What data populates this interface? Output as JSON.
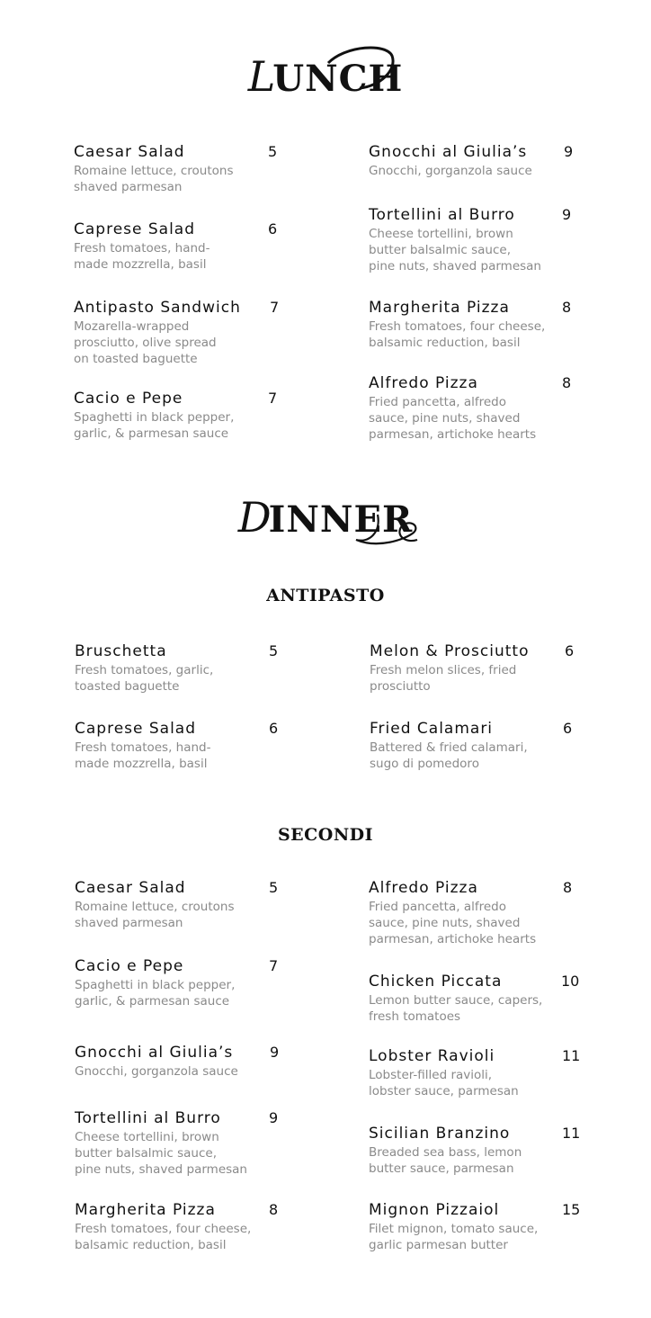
{
  "lunch": {
    "title_initial": "L",
    "title_rest": "UNCH",
    "items": [
      {
        "name": "Caesar Salad",
        "desc": "Romaine lettuce, croutons\nshaved parmesan",
        "price": "5"
      },
      {
        "name": "Caprese Salad",
        "desc": "Fresh tomatoes, hand-\nmade mozzrella, basil",
        "price": "6"
      },
      {
        "name": "Antipasto Sandwich",
        "desc": "Mozarella-wrapped\nprosciutto, olive spread\non toasted baguette",
        "price": "7"
      },
      {
        "name": "Cacio e Pepe",
        "desc": "Spaghetti in black pepper,\ngarlic, & parmesan sauce",
        "price": "7"
      },
      {
        "name": "Gnocchi al Giulia’s",
        "desc": "Gnocchi, gorganzola sauce",
        "price": "9"
      },
      {
        "name": "Tortellini al Burro",
        "desc": "Cheese tortellini, brown\nbutter balsalmic sauce,\npine nuts, shaved parmesan",
        "price": "9"
      },
      {
        "name": "Margherita Pizza",
        "desc": "Fresh tomatoes, four cheese,\nbalsamic reduction, basil",
        "price": "8"
      },
      {
        "name": "Alfredo Pizza",
        "desc": "Fried pancetta, alfredo\nsauce, pine nuts, shaved\nparmesan, artichoke hearts",
        "price": "8"
      }
    ]
  },
  "dinner": {
    "title_initial": "D",
    "title_rest": "INNER",
    "antipasto": {
      "title": "ANTIPASTO",
      "items": [
        {
          "name": "Bruschetta",
          "desc": "Fresh tomatoes, garlic,\ntoasted baguette",
          "price": "5"
        },
        {
          "name": "Caprese Salad",
          "desc": "Fresh tomatoes, hand-\nmade mozzrella, basil",
          "price": "6"
        },
        {
          "name": "Melon & Prosciutto",
          "desc": "Fresh melon slices, fried\nprosciutto",
          "price": "6"
        },
        {
          "name": "Fried Calamari",
          "desc": "Battered & fried calamari,\nsugo di pomedoro",
          "price": "6"
        }
      ]
    },
    "secondi": {
      "title": "SECONDI",
      "items": [
        {
          "name": "Caesar Salad",
          "desc": "Romaine lettuce, croutons\nshaved parmesan",
          "price": "5"
        },
        {
          "name": "Cacio e Pepe",
          "desc": "Spaghetti in black pepper,\ngarlic, & parmesan sauce",
          "price": "7"
        },
        {
          "name": "Gnocchi al Giulia’s",
          "desc": "Gnocchi, gorganzola sauce",
          "price": "9"
        },
        {
          "name": "Tortellini al Burro",
          "desc": "Cheese tortellini, brown\nbutter balsalmic sauce,\npine nuts, shaved parmesan",
          "price": "9"
        },
        {
          "name": "Margherita Pizza",
          "desc": "Fresh tomatoes, four cheese,\nbalsamic reduction, basil",
          "price": "8"
        },
        {
          "name": "Alfredo Pizza",
          "desc": "Fried pancetta, alfredo\nsauce, pine nuts, shaved\nparmesan, artichoke hearts",
          "price": "8"
        },
        {
          "name": "Chicken Piccata",
          "desc": "Lemon butter sauce, capers,\nfresh tomatoes",
          "price": "10"
        },
        {
          "name": "Lobster Ravioli",
          "desc": "Lobster-filled ravioli,\nlobster sauce, parmesan",
          "price": "11"
        },
        {
          "name": "Sicilian Branzino",
          "desc": "Breaded sea bass, lemon\nbutter sauce, parmesan",
          "price": "11"
        },
        {
          "name": "Mignon Pizzaiol",
          "desc": "Filet mignon, tomato sauce,\ngarlic parmesan butter",
          "price": "15"
        }
      ]
    }
  }
}
